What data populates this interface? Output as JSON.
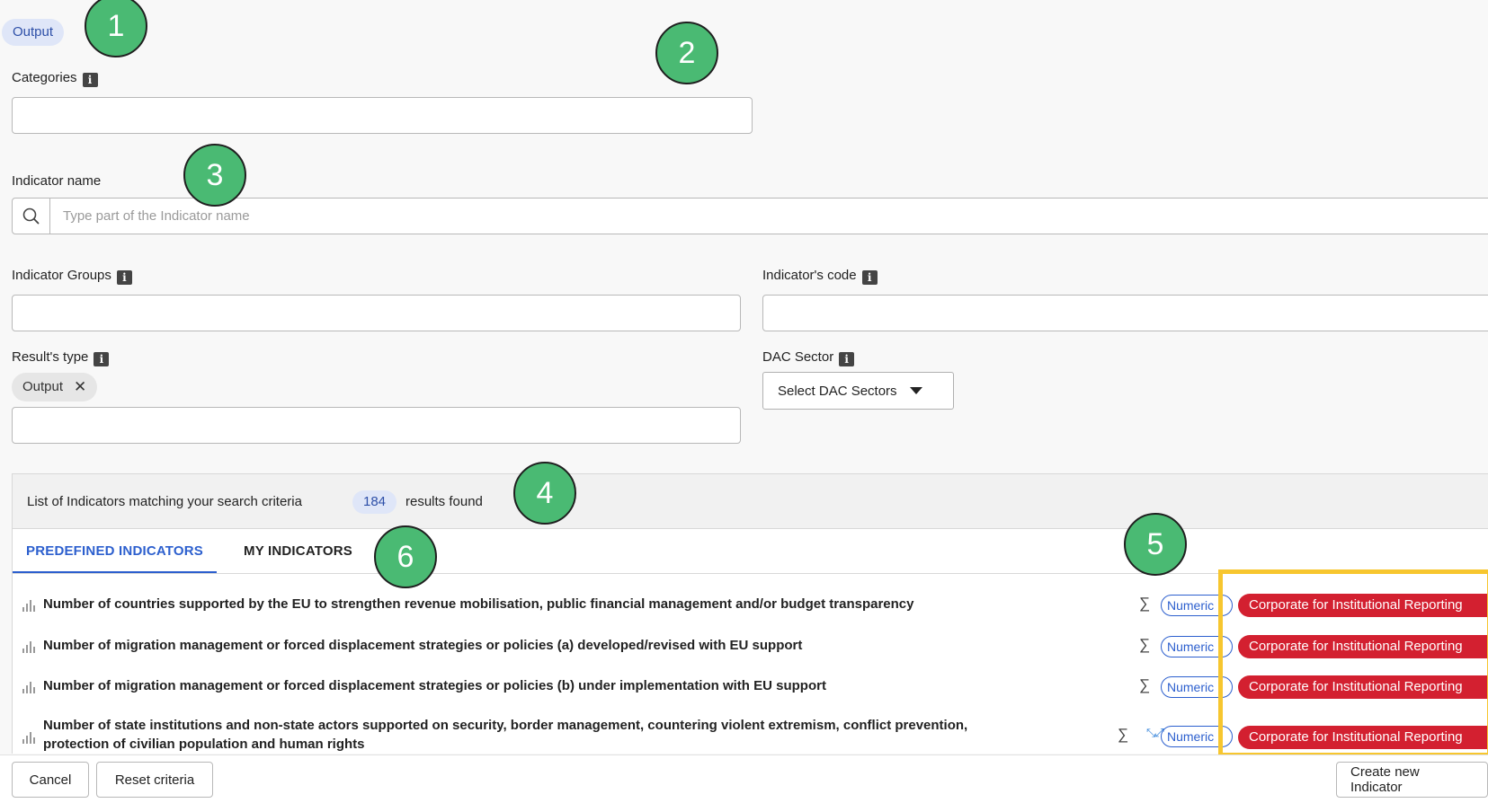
{
  "result_type_chip": "Output",
  "categories": {
    "label": "Categories",
    "info_glyph": "i",
    "value": ""
  },
  "indicator_name": {
    "label": "Indicator name",
    "placeholder": "Type part of the Indicator name",
    "value": ""
  },
  "indicator_groups": {
    "label": "Indicator Groups",
    "info_glyph": "i",
    "value": ""
  },
  "indicator_code": {
    "label": "Indicator's code",
    "info_glyph": "i",
    "value": ""
  },
  "results_type": {
    "label": "Result's type",
    "info_glyph": "i",
    "selected_chip": "Output",
    "remove_glyph": "✕",
    "value": ""
  },
  "dac_sector": {
    "label": "DAC Sector",
    "info_glyph": "i",
    "button_label": "Select DAC Sectors"
  },
  "results": {
    "prefix": "List of Indicators matching your search criteria",
    "count": "184",
    "suffix": "results found"
  },
  "tabs": [
    {
      "label": "PREDEFINED INDICATORS",
      "active": true
    },
    {
      "label": "MY INDICATORS",
      "active": false
    }
  ],
  "rows": [
    {
      "title": "Number of countries supported by the EU to strengthen revenue mobilisation, public financial management and/or budget transparency",
      "sigma": "∑",
      "type": "Numeric",
      "badge": "Corporate for Institutional Reporting"
    },
    {
      "title": "Number of migration management or forced displacement strategies or policies (a) developed/revised with EU support",
      "sigma": "∑",
      "type": "Numeric",
      "badge": "Corporate for Institutional Reporting"
    },
    {
      "title": "Number of migration management or forced displacement strategies or policies (b) under implementation with EU support",
      "sigma": "∑",
      "type": "Numeric",
      "badge": "Corporate for Institutional Reporting"
    },
    {
      "title": "Number of state institutions and non-state actors supported on security, border management, countering violent extremism, conflict prevention,",
      "title_line2": "protection of civilian population and human rights",
      "sigma": "∑",
      "type": "Numeric",
      "badge": "Corporate for Institutional Reporting"
    }
  ],
  "footer": {
    "cancel": "Cancel",
    "reset": "Reset criteria",
    "create": "Create new Indicator"
  },
  "markers": [
    "1",
    "2",
    "3",
    "4",
    "5",
    "6"
  ],
  "colors": {
    "accent": "#2c5fce",
    "badge_red": "#d32030",
    "marker_green": "#4aba73",
    "highlight": "#f7c62f"
  }
}
